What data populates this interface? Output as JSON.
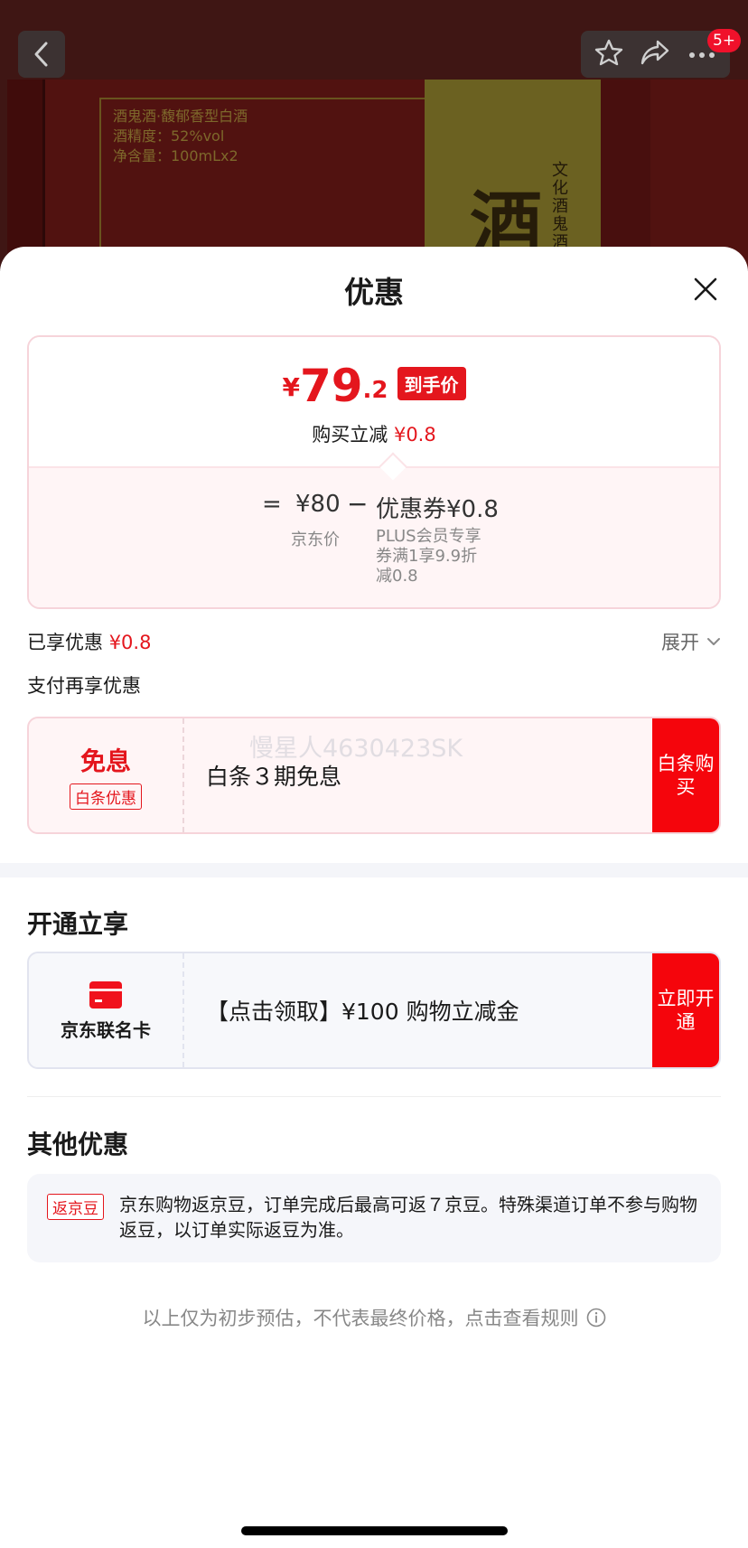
{
  "product_label": {
    "lines": [
      "酒鬼酒·馥郁香型白酒",
      "酒精度：52%vol",
      "净含量：100mLx2"
    ],
    "vertical_1": "文化酒鬼酒",
    "vertical_2": "",
    "calligraphy": "酒"
  },
  "top_nav": {
    "badge": "5+"
  },
  "sheet": {
    "title": "优惠"
  },
  "price": {
    "currency": "¥",
    "integer": "79",
    "decimal": ".2",
    "tag": "到手价",
    "discount_prefix": "购买立减",
    "discount_value": "¥0.8",
    "equals": "=",
    "jd_price": "¥80",
    "jd_price_label": "京东价",
    "minus": "−",
    "coupon": "优惠券¥0.8",
    "coupon_desc": "PLUS会员专享券满1享9.9折减0.8"
  },
  "enjoyed": {
    "label": "已享优惠",
    "value": "¥0.8",
    "expand": "展开"
  },
  "pay_section": {
    "label": "支付再享优惠",
    "card": {
      "title": "免息",
      "tag": "白条优惠",
      "text": "白条３期免息",
      "button": "白条购买"
    },
    "watermark": "慢星人4630423SK"
  },
  "open_section": {
    "title": "开通立享",
    "card": {
      "name": "京东联名卡",
      "text": "【点击领取】¥100 购物立减金",
      "button": "立即开通"
    }
  },
  "other_section": {
    "title": "其他优惠",
    "tag": "返京豆",
    "text": "京东购物返京豆，订单完成后最高可返７京豆。特殊渠道订单不参与购物返豆，以订单实际返豆为准。"
  },
  "footnote": "以上仅为初步预估，不代表最终价格，点击查看规则",
  "colors": {
    "accent_red": "#e4161d",
    "button_red": "#f5050c"
  }
}
